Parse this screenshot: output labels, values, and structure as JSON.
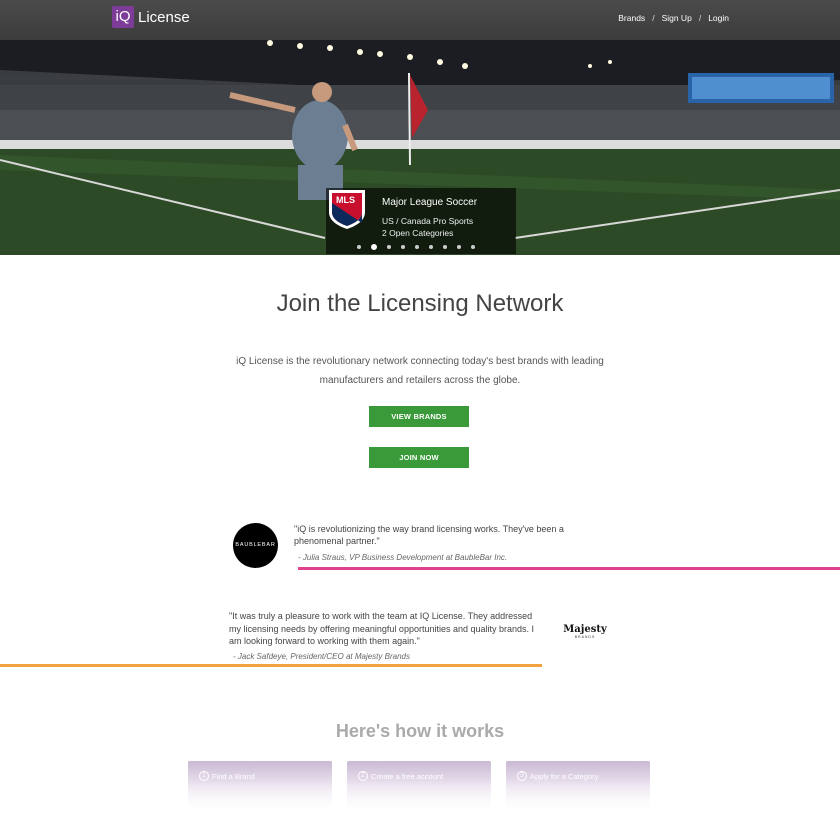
{
  "header": {
    "logo_mark": "iQ",
    "logo_text": "License",
    "nav": {
      "brands": "Brands",
      "signup": "Sign Up",
      "login": "Login",
      "separator": "/"
    }
  },
  "hero": {
    "caption_title": "Major League Soccer",
    "caption_line1": "US / Canada Pro Sports",
    "caption_line2": "2 Open Categories",
    "badge_text": "MLS",
    "slide_count": 9,
    "active_slide": 2
  },
  "main": {
    "headline": "Join the Licensing Network",
    "lead": "iQ License is the revolutionary network connecting today's best brands with leading manufacturers and retailers across the globe.",
    "view_brands": "VIEW BRANDS",
    "join_now": "JOIN NOW"
  },
  "testimonials": [
    {
      "logo_text": "BAUBLEBAR",
      "quote": "\"iQ is revolutionizing the way brand licensing works. They've been a phenomenal partner.\"",
      "author": "- Julia Straus, VP Business Development at BaubleBar Inc.",
      "accent": "#e0428f"
    },
    {
      "logo_text": "Majesty",
      "logo_sub": "BRANDS",
      "quote": "\"It was truly a pleasure to work with the team at IQ License. They addressed my licensing needs by offering meaningful opportunities and quality brands. I am looking forward to working with them again.\"",
      "author": "- Jack Safdeye, President/CEO at Majesty Brands",
      "accent": "#f0a340"
    }
  ],
  "how": {
    "title": "Here's how it works",
    "steps": [
      {
        "num": "1",
        "label": "Find a Brand"
      },
      {
        "num": "2",
        "label": "Create a free account"
      },
      {
        "num": "3",
        "label": "Apply for a Category"
      }
    ]
  },
  "colors": {
    "brand_purple": "#7d3c98",
    "button_green": "#3a9a3a",
    "header_bg": "#444444"
  }
}
